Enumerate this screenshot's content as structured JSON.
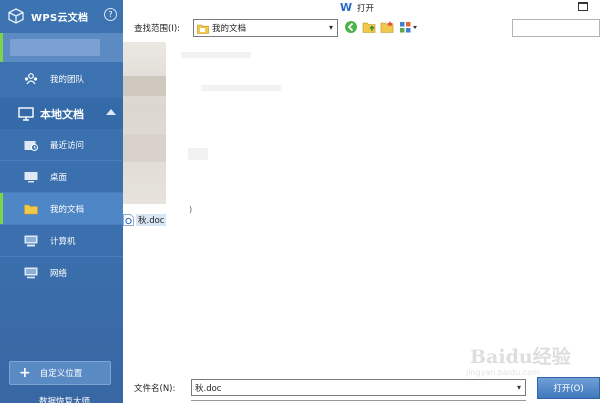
{
  "sidebar": {
    "app_title": "WPS云文档",
    "help_label": "?",
    "team_label": "我的团队",
    "local_docs_label": "本地文档",
    "items": [
      {
        "label": "最近访问"
      },
      {
        "label": "桌面"
      },
      {
        "label": "我的文档"
      },
      {
        "label": "计算机"
      },
      {
        "label": "网络"
      }
    ],
    "custom_location_label": "自定义位置",
    "bottom_cut_label": "数据恢复大师"
  },
  "dialog": {
    "title": "打开",
    "look_in_label": "查找范围(I):",
    "look_in_value": "我的文档",
    "file_name_label": "文件名(N):",
    "file_name_value": "秋.doc",
    "open_button_label": "打开(O)",
    "files": [
      {
        "name": "秋.doc",
        "selected": true
      }
    ],
    "stray_char": ")"
  },
  "watermark": {
    "text": "Baidu经验",
    "url_text": "jingyan.baidu.com"
  },
  "colors": {
    "sidebar_bg": "#3b6fad",
    "selected_marker": "#7fd24c",
    "accent": "#2a6cc4"
  }
}
